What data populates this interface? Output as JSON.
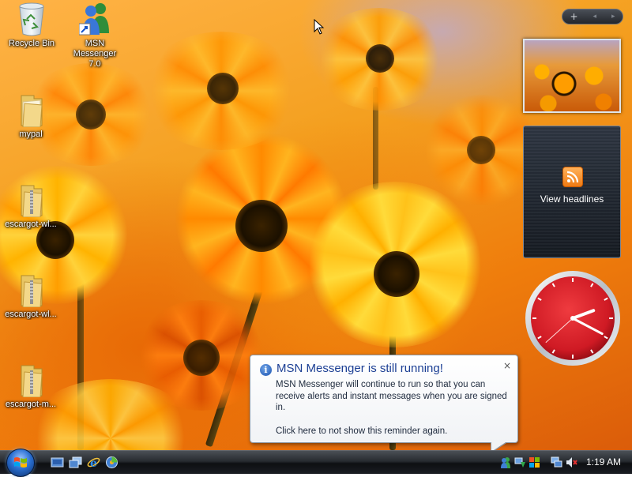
{
  "desktop": {
    "icons": [
      {
        "label": "Recycle Bin"
      },
      {
        "label": "MSN Messenger 7.0"
      },
      {
        "label": "mypal"
      },
      {
        "label": "escargot-wl..."
      },
      {
        "label": "escargot-wl..."
      },
      {
        "label": "escargot-m..."
      }
    ]
  },
  "sidebar": {
    "controls": {
      "add": "+",
      "prev": "◂",
      "next": "▸"
    },
    "feed": {
      "label": "View headlines"
    },
    "clock": {
      "hour": 2,
      "minute": 19,
      "second": 38
    }
  },
  "notification": {
    "title": "MSN Messenger is still running!",
    "close": "×",
    "body": "MSN Messenger will continue to run so that you can receive alerts and instant messages when you are signed in.",
    "link": "Click here to not show this reminder again."
  },
  "taskbar": {
    "clock": "1:19 AM"
  },
  "colors": {
    "balloon_title": "#1c3f94",
    "clock_face": "#d81f2a",
    "rss": "#f07a12"
  }
}
